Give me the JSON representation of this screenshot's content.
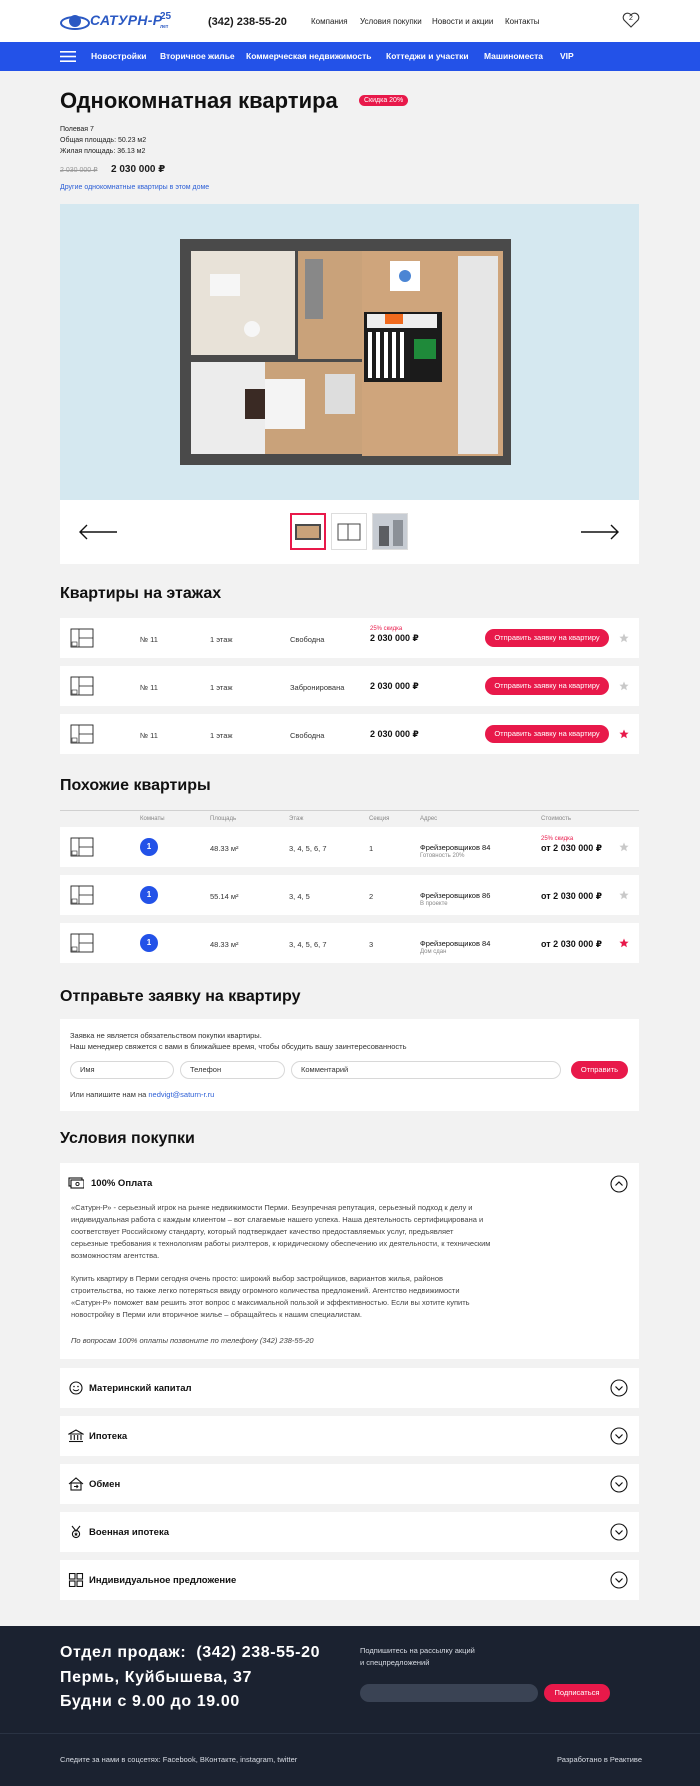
{
  "header": {
    "logo_text": "САТУРН-Р",
    "logo_years": "25",
    "logo_years_sub": "лет",
    "phone": "(342) 238-55-20",
    "nav": [
      "Компания",
      "Условия покупки",
      "Новости и акции",
      "Контакты"
    ],
    "favorites_count": "2"
  },
  "mainnav": [
    "Новостройки",
    "Вторичное жилье",
    "Коммерческая недвижимость",
    "Коттеджи и участки",
    "Машиноместа",
    "VIP"
  ],
  "listing": {
    "title": "Однокомнатная квартира",
    "discount_badge": "Скидка 20%",
    "street": "Полевая 7",
    "total_area": "Общая площадь: 50.23 м2",
    "living_area": "Жилая площадь: 36.13 м2",
    "old_price": "2 030 000 ₽",
    "price": "2 030 000 ₽",
    "other_link": "Другие однокомнатные квартиры в этом доме"
  },
  "floors": {
    "heading": "Квартиры на этажах",
    "rows": [
      {
        "num": "№ 11",
        "floor": "1 этаж",
        "status": "Свободна",
        "tag": "25% скидка",
        "price": "2 030 000 ₽",
        "button": "Отправить заявку на квартиру",
        "fav": false
      },
      {
        "num": "№ 11",
        "floor": "1 этаж",
        "status": "Забронирована",
        "tag": "",
        "price": "2 030 000 ₽",
        "button": "Отправить заявку на квартиру",
        "fav": false
      },
      {
        "num": "№ 11",
        "floor": "1 этаж",
        "status": "Свободна",
        "tag": "",
        "price": "2 030 000 ₽",
        "button": "Отправить заявку на квартиру",
        "fav": true
      }
    ]
  },
  "similar": {
    "heading": "Похожие квартиры",
    "columns": [
      "Комнаты",
      "Площадь",
      "Этаж",
      "Секция",
      "Адрес",
      "Стоимость"
    ],
    "rows": [
      {
        "rooms": "1",
        "area": "48.33 м²",
        "floors": "3, 4, 5, 6, 7",
        "section": "1",
        "address": "Фрейзеровщиков 84",
        "address_note": "Готовность 20%",
        "tag": "25% скидка",
        "price": "от 2 030 000 ₽",
        "fav": false
      },
      {
        "rooms": "1",
        "area": "55.14 м²",
        "floors": "3, 4, 5",
        "section": "2",
        "address": "Фрейзеровщиков 86",
        "address_note": "В проекте",
        "tag": "",
        "price": "от 2 030 000 ₽",
        "fav": false
      },
      {
        "rooms": "1",
        "area": "48.33 м²",
        "floors": "3, 4, 5, 6, 7",
        "section": "3",
        "address": "Фрейзеровщиков 84",
        "address_note": "Дом сдан",
        "tag": "",
        "price": "от 2 030 000 ₽",
        "fav": true
      }
    ]
  },
  "request": {
    "heading": "Отправьте заявку на квартиру",
    "line1": "Заявка не является обязательством покупки квартиры.",
    "line2": "Наш менеджер свяжется с вами в ближайшее время, чтобы обсудить вашу заинтересованность",
    "name_placeholder": "Имя",
    "phone_placeholder": "Телефон",
    "comment_placeholder": "Комментарий",
    "submit": "Отправить",
    "email_prefix": "Или напишите нам на ",
    "email": "nedvigt@saturn-r.ru"
  },
  "terms": {
    "heading": "Условия покупки",
    "open": {
      "title": "100% Оплата",
      "p1": "«Сатурн-Р» - серьезный игрок на рынке недвижимости Перми. Безупречная репутация, серьезный подход к делу и индивидуальная работа с каждым клиентом – вот слагаемые нашего успеха.  Наша деятельность сертифицирована и соответствует Российскому стандарту, который подтверждает качество предоставляемых услуг, предъявляет серьезные требования к технологиям работы  риэлтеров, к юридическому обеспечению их деятельности, к техническим возможностям агентства.",
      "p2": "Купить квартиру в Перми сегодня очень просто: широкий выбор застройщиков, вариантов жилья, районов строительства, но также легко потеряться ввиду огромного количества предложений. Агентство недвижимости «Сатурн-Р» поможет вам решить этот вопрос с максимальной пользой и эффективностью. Если вы хотите купить новостройку в Перми или вторичное жилье – обращайтесь к нашим специалистам.",
      "p3": "По вопросам 100% оплаты позвоните по телефону (342) 238-55-20"
    },
    "items": [
      "Материнский капитал",
      "Ипотека",
      "Обмен",
      "Военная ипотека",
      "Индивидуальное предложение"
    ]
  },
  "footer": {
    "sales_label": "Отдел продаж:",
    "sales_phone": "(342) 238-55-20",
    "address": "Пермь, Куйбышева, 37",
    "hours": "Будни с 9.00 до 19.00",
    "subscribe_line1": "Подпишитесь на рассылку акций",
    "subscribe_line2": "и спецпредложений",
    "subscribe_button": "Подписаться",
    "social": "Следите за нами в соцсетях: Facebook, ВКонтакте, instagram, twitter",
    "credit": "Разработано в Реактиве"
  },
  "colors": {
    "accent": "#2352e8",
    "red": "#e8194a",
    "footer": "#1b2230"
  }
}
